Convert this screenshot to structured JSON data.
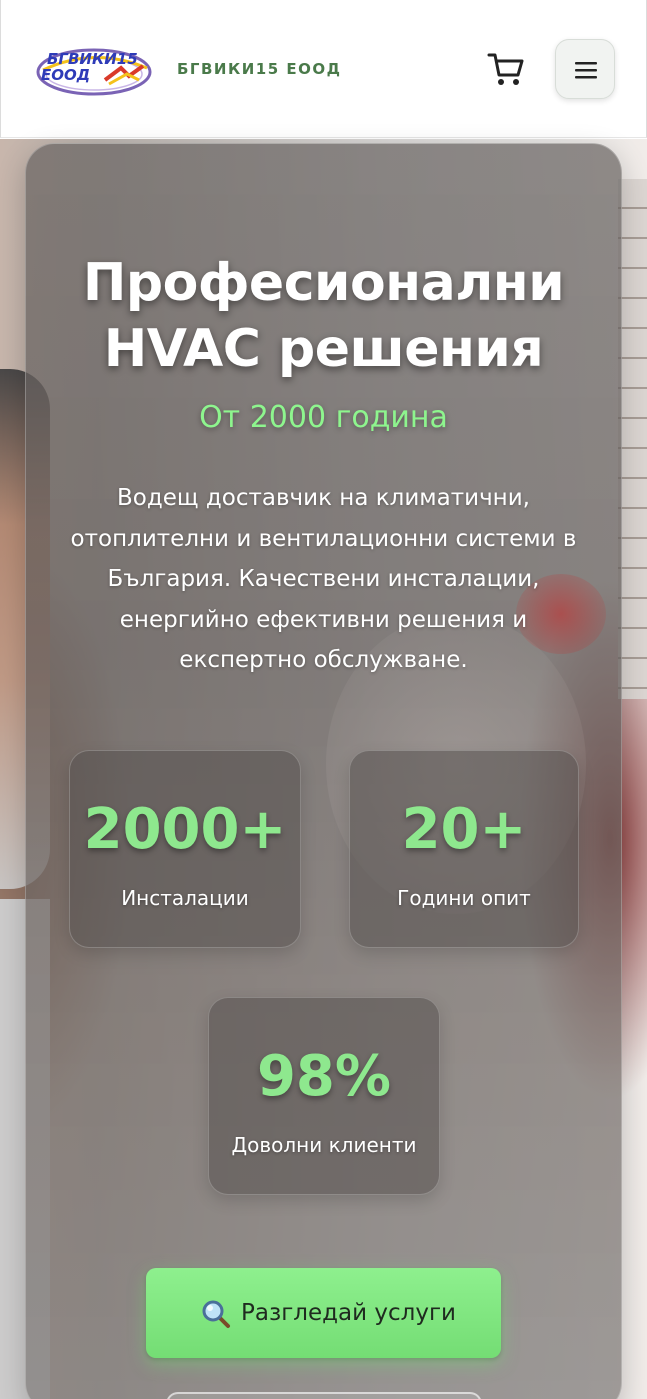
{
  "header": {
    "logo_text_top": "БГВИКИ15",
    "logo_text_bottom": "ЕООД",
    "brand_name": "БГВИКИ15 ЕООД",
    "cart_icon": "cart-icon",
    "menu_icon": "hamburger-icon"
  },
  "hero": {
    "title_line1": "Професионални",
    "title_line2": "HVAC решения",
    "subtitle": "От 2000 година",
    "description": "Водещ доставчик на климатични, отоплителни и вентилационни системи в България. Качествени инсталации, енергийно ефективни решения и експертно обслужване.",
    "stats": [
      {
        "value": "2000+",
        "label": "Инсталации"
      },
      {
        "value": "20+",
        "label": "Години опит"
      },
      {
        "value": "98%",
        "label": "Доволни клиенти"
      }
    ],
    "cta_label": "Разгледай услуги",
    "cta_icon": "magnifier-icon"
  },
  "colors": {
    "accent_green": "#8ef58e",
    "brand_text": "#4a7a4a",
    "cta_green": "#74dd74"
  }
}
